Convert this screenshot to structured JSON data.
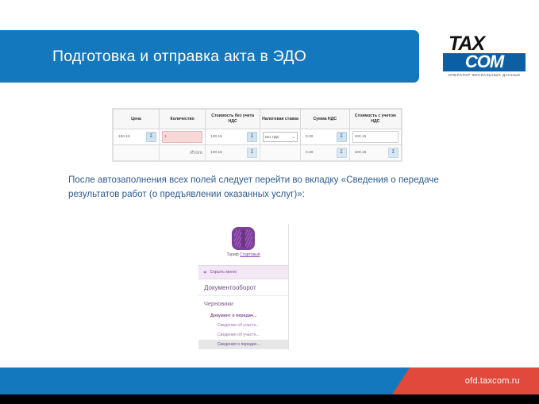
{
  "slide": {
    "title": "Подготовка и отправка акта в ЭДО",
    "body_text": "После автозаполнения всех полей следует перейти во вкладку «Сведения о передаче результатов работ (о предъявлении оказанных услуг)»:"
  },
  "logo": {
    "top": "TAX",
    "bottom": "COM",
    "subtitle": "Оператор фискальных данных"
  },
  "table": {
    "headers": [
      "Цена",
      "Количество",
      "Стоимость без учета НДС",
      "Налоговая ставка",
      "Сумма НДС",
      "Стоимость с учетом НДС"
    ],
    "sigma_symbol": "Σ",
    "chevron": "⌄",
    "row": {
      "price": "100.15",
      "quantity": "1",
      "cost_without_vat": "100.15",
      "vat_rate": "Без НДС",
      "vat_sum": "0.00",
      "cost_with_vat": "100.15"
    },
    "total_row": {
      "label": "Итого",
      "cost_without_vat": "100.15",
      "vat_sum": "0.00",
      "cost_with_vat": "100.15"
    }
  },
  "menu": {
    "tariff_label": "Тариф",
    "tariff_value": "Стартовый",
    "hide_menu": "Скрыть меню",
    "hide_icon": "«",
    "main_item": "Документооборот",
    "section": "Черновики",
    "sub_item": "Документ о передач...",
    "children": [
      "Сведения об участн...",
      "Сведения об участн...",
      "Сведения о передач..."
    ],
    "selected_index": 2
  },
  "footer": {
    "url": "ofd.taxcom.ru"
  },
  "colors": {
    "brand_blue": "#1378bd",
    "brand_red": "#e1493c",
    "body_text_blue": "#2d5b8e",
    "menu_purple": "#8446a4"
  }
}
